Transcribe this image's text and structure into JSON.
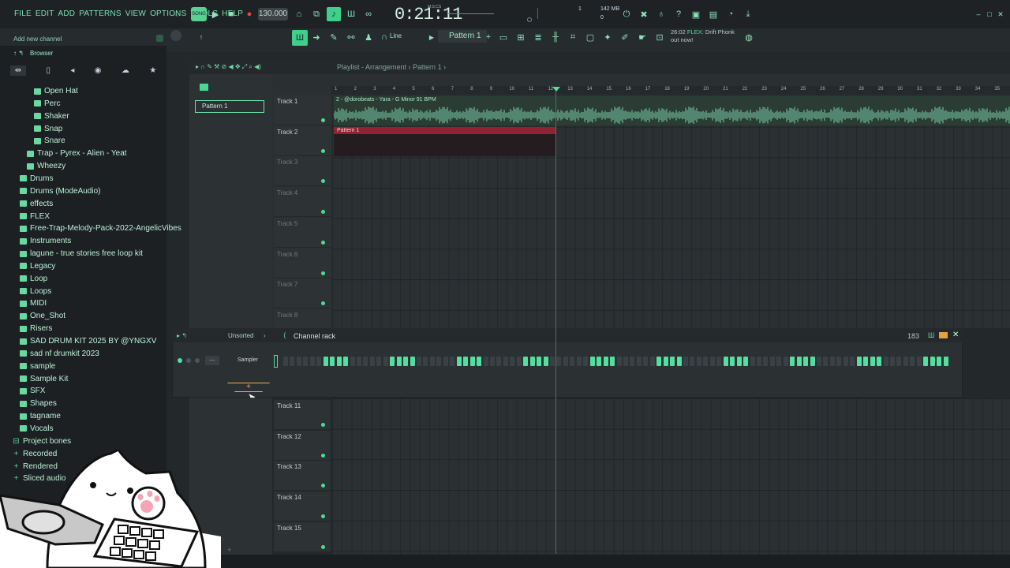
{
  "menu": [
    "FILE",
    "EDIT",
    "ADD",
    "PATTERNS",
    "VIEW",
    "OPTIONS",
    "TOOLS",
    "HELP"
  ],
  "transport": {
    "mode_label": "SONG",
    "tempo": "130.000",
    "time": "0:21:11",
    "time_unit": "M:S:CS",
    "memory": "142 MB",
    "cpu_value": "1",
    "cpu_sub": "0"
  },
  "hint_text": "Add new channel",
  "toolbar": {
    "snap_label": "Line",
    "pattern_selector": "Pattern 1"
  },
  "news": {
    "time": "26:02",
    "brand": "FLEX:",
    "line1": "Drift Phonk",
    "line2": "out now!"
  },
  "browser": {
    "title": "Browser",
    "items": [
      {
        "label": "Open Hat",
        "indent": 3,
        "type": "folder"
      },
      {
        "label": "Perc",
        "indent": 3,
        "type": "folder"
      },
      {
        "label": "Shaker",
        "indent": 3,
        "type": "folder"
      },
      {
        "label": "Snap",
        "indent": 3,
        "type": "folder"
      },
      {
        "label": "Snare",
        "indent": 3,
        "type": "folder"
      },
      {
        "label": "Trap - Pyrex - Alien - Yeat",
        "indent": 2,
        "type": "folder"
      },
      {
        "label": "Wheezy",
        "indent": 2,
        "type": "folder"
      },
      {
        "label": "Drums",
        "indent": 1,
        "type": "folder"
      },
      {
        "label": "Drums (ModeAudio)",
        "indent": 1,
        "type": "folder"
      },
      {
        "label": "effects",
        "indent": 1,
        "type": "folder"
      },
      {
        "label": "FLEX",
        "indent": 1,
        "type": "folder"
      },
      {
        "label": "Free-Trap-Melody-Pack-2022-AngelicVibes",
        "indent": 1,
        "type": "folder"
      },
      {
        "label": "Instruments",
        "indent": 1,
        "type": "folder"
      },
      {
        "label": "lagune - true stories free loop kit",
        "indent": 1,
        "type": "folder"
      },
      {
        "label": "Legacy",
        "indent": 1,
        "type": "folder"
      },
      {
        "label": "Loop",
        "indent": 1,
        "type": "folder"
      },
      {
        "label": "Loops",
        "indent": 1,
        "type": "folder"
      },
      {
        "label": "MIDI",
        "indent": 1,
        "type": "folder"
      },
      {
        "label": "One_Shot",
        "indent": 1,
        "type": "folder"
      },
      {
        "label": "Risers",
        "indent": 1,
        "type": "folder"
      },
      {
        "label": "SAD DRUM KIT 2025 BY @YNGXV",
        "indent": 1,
        "type": "folder"
      },
      {
        "label": "sad nf drumkit 2023",
        "indent": 1,
        "type": "folder"
      },
      {
        "label": "sample",
        "indent": 1,
        "type": "folder"
      },
      {
        "label": "Sample Kit",
        "indent": 1,
        "type": "folder"
      },
      {
        "label": "SFX",
        "indent": 1,
        "type": "folder"
      },
      {
        "label": "Shapes",
        "indent": 1,
        "type": "folder"
      },
      {
        "label": "tagname",
        "indent": 1,
        "type": "folder"
      },
      {
        "label": "Vocals",
        "indent": 1,
        "type": "folder"
      },
      {
        "label": "Project bones",
        "indent": 0,
        "type": "root"
      },
      {
        "label": "Recorded",
        "indent": 0,
        "type": "plus"
      },
      {
        "label": "Rendered",
        "indent": 0,
        "type": "plus"
      },
      {
        "label": "Sliced audio",
        "indent": 0,
        "type": "plus"
      }
    ]
  },
  "playlist": {
    "title": "Playlist - Arrangement",
    "pattern": "Pattern 1",
    "pattern_list_item": "Pattern 1",
    "ruler": [
      "1",
      "2",
      "3",
      "4",
      "5",
      "6",
      "7",
      "8",
      "9",
      "10",
      "11",
      "12",
      "13",
      "14",
      "15",
      "16",
      "17",
      "18",
      "19",
      "20",
      "21",
      "22",
      "23",
      "24",
      "25",
      "26",
      "27",
      "28",
      "29",
      "30",
      "31",
      "32",
      "33",
      "34",
      "35"
    ],
    "tracks_top": [
      "Track 1",
      "Track 2",
      "Track 3",
      "Track 4",
      "Track 5",
      "Track 6",
      "Track 7",
      "Track 8"
    ],
    "tracks_bottom": [
      "Track 11",
      "Track 12",
      "Track 13",
      "Track 14",
      "Track 15"
    ],
    "audio_clip_title": "2 - @dorobeats - Yara - G Minor 91 BPM",
    "pattern_clip_title": "Pattern 1"
  },
  "channel_rack": {
    "filter": "Unsorted",
    "title": "Channel rack",
    "count": "183",
    "channel_name": "Sampler",
    "steps": [
      0,
      0,
      0,
      0,
      0,
      0,
      1,
      1,
      1,
      1,
      0,
      0,
      0,
      0,
      0,
      0,
      1,
      1,
      1,
      1,
      0,
      0,
      0,
      0,
      0,
      0,
      1,
      1,
      1,
      1,
      0,
      0,
      0,
      0,
      0,
      0,
      1,
      1,
      1,
      1,
      0,
      0,
      0,
      0,
      0,
      0,
      1,
      1,
      1,
      1,
      0,
      0,
      0,
      0,
      0,
      0,
      1,
      1,
      1,
      1,
      0,
      0,
      0,
      0,
      0,
      0,
      1,
      1,
      1,
      1,
      0,
      0,
      0,
      0,
      0,
      0,
      1,
      1,
      1,
      1,
      0,
      0,
      0,
      0,
      0,
      0,
      1,
      1,
      1,
      1,
      0,
      0,
      0,
      0,
      0,
      0,
      1,
      1,
      1,
      1
    ],
    "add_label": "+"
  },
  "colors": {
    "accent": "#52e0a0",
    "pattern_clip": "#8f2333",
    "audio_clip": "#2a3c34"
  }
}
